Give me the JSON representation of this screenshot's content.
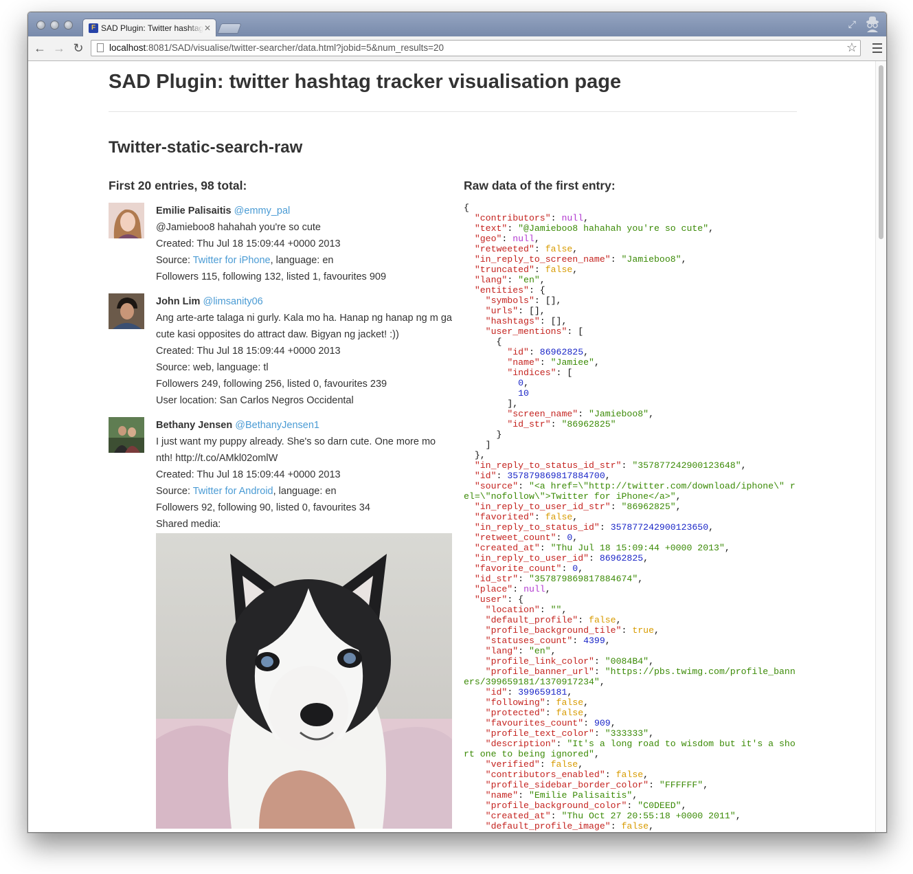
{
  "browser": {
    "tab_title": "SAD Plugin: Twitter hashtag tracker visualisation page",
    "url_host": "localhost",
    "url_rest": ":8081/SAD/visualise/twitter-searcher/data.html?jobid=5&num_results=20"
  },
  "page": {
    "title": "SAD Plugin: twitter hashtag tracker visualisation page",
    "section": "Twitter-static-search-raw",
    "entries_heading": "First 20 entries, 98 total:",
    "raw_heading": "Raw data of the first entry:"
  },
  "tweets": [
    {
      "name": "Emilie Palisaitis",
      "handle": "@emmy_pal",
      "text": "@Jamieboo8 hahahah you're so cute",
      "created": "Created: Thu Jul 18 15:09:44 +0000 2013",
      "source_prefix": "Source: ",
      "source_link": "Twitter for iPhone",
      "source_suffix": ", language: en",
      "stats": "Followers 115, following 132, listed 1, favourites 909"
    },
    {
      "name": "John Lim",
      "handle": "@limsanity06",
      "text": "Ang arte-arte talaga ni gurly. Kala mo ha. Hanap ng hanap ng m ga cute kasi opposites do attract daw. Bigyan ng jacket! :))",
      "created": "Created: Thu Jul 18 15:09:44 +0000 2013",
      "source_prefix": "Source: web, language: tl",
      "stats": "Followers 249, following 256, listed 0, favourites 239",
      "location": "User location: San Carlos Negros Occidental"
    },
    {
      "name": "Bethany Jensen",
      "handle": "@BethanyJensen1",
      "text": "I just want my puppy already. She's so darn cute. One more mo nth! http://t.co/AMkl02omlW",
      "created": "Created: Thu Jul 18 15:09:44 +0000 2013",
      "source_prefix": "Source: ",
      "source_link": "Twitter for Android",
      "source_suffix": ", language: en",
      "stats": "Followers 92, following 90, listed 0, favourites 34",
      "media_label": "Shared media:"
    }
  ],
  "raw_json_lines": [
    [
      [
        "p",
        "{"
      ]
    ],
    [
      [
        "p",
        "  "
      ],
      [
        "k",
        "\"contributors\""
      ],
      [
        "p",
        ": "
      ],
      [
        "nl",
        "null"
      ],
      [
        "p",
        ","
      ]
    ],
    [
      [
        "p",
        "  "
      ],
      [
        "k",
        "\"text\""
      ],
      [
        "p",
        ": "
      ],
      [
        "s",
        "\"@Jamieboo8 hahahah you're so cute\""
      ],
      [
        "p",
        ","
      ]
    ],
    [
      [
        "p",
        "  "
      ],
      [
        "k",
        "\"geo\""
      ],
      [
        "p",
        ": "
      ],
      [
        "nl",
        "null"
      ],
      [
        "p",
        ","
      ]
    ],
    [
      [
        "p",
        "  "
      ],
      [
        "k",
        "\"retweeted\""
      ],
      [
        "p",
        ": "
      ],
      [
        "b",
        "false"
      ],
      [
        "p",
        ","
      ]
    ],
    [
      [
        "p",
        "  "
      ],
      [
        "k",
        "\"in_reply_to_screen_name\""
      ],
      [
        "p",
        ": "
      ],
      [
        "s",
        "\"Jamieboo8\""
      ],
      [
        "p",
        ","
      ]
    ],
    [
      [
        "p",
        "  "
      ],
      [
        "k",
        "\"truncated\""
      ],
      [
        "p",
        ": "
      ],
      [
        "b",
        "false"
      ],
      [
        "p",
        ","
      ]
    ],
    [
      [
        "p",
        "  "
      ],
      [
        "k",
        "\"lang\""
      ],
      [
        "p",
        ": "
      ],
      [
        "s",
        "\"en\""
      ],
      [
        "p",
        ","
      ]
    ],
    [
      [
        "p",
        "  "
      ],
      [
        "k",
        "\"entities\""
      ],
      [
        "p",
        ": {"
      ]
    ],
    [
      [
        "p",
        "    "
      ],
      [
        "k",
        "\"symbols\""
      ],
      [
        "p",
        ": [],"
      ]
    ],
    [
      [
        "p",
        "    "
      ],
      [
        "k",
        "\"urls\""
      ],
      [
        "p",
        ": [],"
      ]
    ],
    [
      [
        "p",
        "    "
      ],
      [
        "k",
        "\"hashtags\""
      ],
      [
        "p",
        ": [],"
      ]
    ],
    [
      [
        "p",
        "    "
      ],
      [
        "k",
        "\"user_mentions\""
      ],
      [
        "p",
        ": ["
      ]
    ],
    [
      [
        "p",
        "      {"
      ]
    ],
    [
      [
        "p",
        "        "
      ],
      [
        "k",
        "\"id\""
      ],
      [
        "p",
        ": "
      ],
      [
        "n",
        "86962825"
      ],
      [
        "p",
        ","
      ]
    ],
    [
      [
        "p",
        "        "
      ],
      [
        "k",
        "\"name\""
      ],
      [
        "p",
        ": "
      ],
      [
        "s",
        "\"Jamiee\""
      ],
      [
        "p",
        ","
      ]
    ],
    [
      [
        "p",
        "        "
      ],
      [
        "k",
        "\"indices\""
      ],
      [
        "p",
        ": ["
      ]
    ],
    [
      [
        "p",
        "          "
      ],
      [
        "n",
        "0"
      ],
      [
        "p",
        ","
      ]
    ],
    [
      [
        "p",
        "          "
      ],
      [
        "n",
        "10"
      ]
    ],
    [
      [
        "p",
        "        ],"
      ]
    ],
    [
      [
        "p",
        "        "
      ],
      [
        "k",
        "\"screen_name\""
      ],
      [
        "p",
        ": "
      ],
      [
        "s",
        "\"Jamieboo8\""
      ],
      [
        "p",
        ","
      ]
    ],
    [
      [
        "p",
        "        "
      ],
      [
        "k",
        "\"id_str\""
      ],
      [
        "p",
        ": "
      ],
      [
        "s",
        "\"86962825\""
      ]
    ],
    [
      [
        "p",
        "      }"
      ]
    ],
    [
      [
        "p",
        "    ]"
      ]
    ],
    [
      [
        "p",
        "  },"
      ]
    ],
    [
      [
        "p",
        "  "
      ],
      [
        "k",
        "\"in_reply_to_status_id_str\""
      ],
      [
        "p",
        ": "
      ],
      [
        "s",
        "\"357877242900123648\""
      ],
      [
        "p",
        ","
      ]
    ],
    [
      [
        "p",
        "  "
      ],
      [
        "k",
        "\"id\""
      ],
      [
        "p",
        ": "
      ],
      [
        "n",
        "357879869817884700"
      ],
      [
        "p",
        ","
      ]
    ],
    [
      [
        "p",
        "  "
      ],
      [
        "k",
        "\"source\""
      ],
      [
        "p",
        ": "
      ],
      [
        "s",
        "\"<a href=\\\"http://twitter.com/download/iphone\\\" rel=\\\"nofollow\\\">Twitter for iPhone</a>\""
      ],
      [
        "p",
        ","
      ]
    ],
    [
      [
        "p",
        "  "
      ],
      [
        "k",
        "\"in_reply_to_user_id_str\""
      ],
      [
        "p",
        ": "
      ],
      [
        "s",
        "\"86962825\""
      ],
      [
        "p",
        ","
      ]
    ],
    [
      [
        "p",
        "  "
      ],
      [
        "k",
        "\"favorited\""
      ],
      [
        "p",
        ": "
      ],
      [
        "b",
        "false"
      ],
      [
        "p",
        ","
      ]
    ],
    [
      [
        "p",
        "  "
      ],
      [
        "k",
        "\"in_reply_to_status_id\""
      ],
      [
        "p",
        ": "
      ],
      [
        "n",
        "357877242900123650"
      ],
      [
        "p",
        ","
      ]
    ],
    [
      [
        "p",
        "  "
      ],
      [
        "k",
        "\"retweet_count\""
      ],
      [
        "p",
        ": "
      ],
      [
        "n",
        "0"
      ],
      [
        "p",
        ","
      ]
    ],
    [
      [
        "p",
        "  "
      ],
      [
        "k",
        "\"created_at\""
      ],
      [
        "p",
        ": "
      ],
      [
        "s",
        "\"Thu Jul 18 15:09:44 +0000 2013\""
      ],
      [
        "p",
        ","
      ]
    ],
    [
      [
        "p",
        "  "
      ],
      [
        "k",
        "\"in_reply_to_user_id\""
      ],
      [
        "p",
        ": "
      ],
      [
        "n",
        "86962825"
      ],
      [
        "p",
        ","
      ]
    ],
    [
      [
        "p",
        "  "
      ],
      [
        "k",
        "\"favorite_count\""
      ],
      [
        "p",
        ": "
      ],
      [
        "n",
        "0"
      ],
      [
        "p",
        ","
      ]
    ],
    [
      [
        "p",
        "  "
      ],
      [
        "k",
        "\"id_str\""
      ],
      [
        "p",
        ": "
      ],
      [
        "s",
        "\"357879869817884674\""
      ],
      [
        "p",
        ","
      ]
    ],
    [
      [
        "p",
        "  "
      ],
      [
        "k",
        "\"place\""
      ],
      [
        "p",
        ": "
      ],
      [
        "nl",
        "null"
      ],
      [
        "p",
        ","
      ]
    ],
    [
      [
        "p",
        "  "
      ],
      [
        "k",
        "\"user\""
      ],
      [
        "p",
        ": {"
      ]
    ],
    [
      [
        "p",
        "    "
      ],
      [
        "k",
        "\"location\""
      ],
      [
        "p",
        ": "
      ],
      [
        "s",
        "\"\""
      ],
      [
        "p",
        ","
      ]
    ],
    [
      [
        "p",
        "    "
      ],
      [
        "k",
        "\"default_profile\""
      ],
      [
        "p",
        ": "
      ],
      [
        "b",
        "false"
      ],
      [
        "p",
        ","
      ]
    ],
    [
      [
        "p",
        "    "
      ],
      [
        "k",
        "\"profile_background_tile\""
      ],
      [
        "p",
        ": "
      ],
      [
        "b",
        "true"
      ],
      [
        "p",
        ","
      ]
    ],
    [
      [
        "p",
        "    "
      ],
      [
        "k",
        "\"statuses_count\""
      ],
      [
        "p",
        ": "
      ],
      [
        "n",
        "4399"
      ],
      [
        "p",
        ","
      ]
    ],
    [
      [
        "p",
        "    "
      ],
      [
        "k",
        "\"lang\""
      ],
      [
        "p",
        ": "
      ],
      [
        "s",
        "\"en\""
      ],
      [
        "p",
        ","
      ]
    ],
    [
      [
        "p",
        "    "
      ],
      [
        "k",
        "\"profile_link_color\""
      ],
      [
        "p",
        ": "
      ],
      [
        "s",
        "\"0084B4\""
      ],
      [
        "p",
        ","
      ]
    ],
    [
      [
        "p",
        "    "
      ],
      [
        "k",
        "\"profile_banner_url\""
      ],
      [
        "p",
        ": "
      ],
      [
        "s",
        "\"https://pbs.twimg.com/profile_banners/399659181/1370917234\""
      ],
      [
        "p",
        ","
      ]
    ],
    [
      [
        "p",
        "    "
      ],
      [
        "k",
        "\"id\""
      ],
      [
        "p",
        ": "
      ],
      [
        "n",
        "399659181"
      ],
      [
        "p",
        ","
      ]
    ],
    [
      [
        "p",
        "    "
      ],
      [
        "k",
        "\"following\""
      ],
      [
        "p",
        ": "
      ],
      [
        "b",
        "false"
      ],
      [
        "p",
        ","
      ]
    ],
    [
      [
        "p",
        "    "
      ],
      [
        "k",
        "\"protected\""
      ],
      [
        "p",
        ": "
      ],
      [
        "b",
        "false"
      ],
      [
        "p",
        ","
      ]
    ],
    [
      [
        "p",
        "    "
      ],
      [
        "k",
        "\"favourites_count\""
      ],
      [
        "p",
        ": "
      ],
      [
        "n",
        "909"
      ],
      [
        "p",
        ","
      ]
    ],
    [
      [
        "p",
        "    "
      ],
      [
        "k",
        "\"profile_text_color\""
      ],
      [
        "p",
        ": "
      ],
      [
        "s",
        "\"333333\""
      ],
      [
        "p",
        ","
      ]
    ],
    [
      [
        "p",
        "    "
      ],
      [
        "k",
        "\"description\""
      ],
      [
        "p",
        ": "
      ],
      [
        "s",
        "\"It's a long road to wisdom but it's a short one to being ignored\""
      ],
      [
        "p",
        ","
      ]
    ],
    [
      [
        "p",
        "    "
      ],
      [
        "k",
        "\"verified\""
      ],
      [
        "p",
        ": "
      ],
      [
        "b",
        "false"
      ],
      [
        "p",
        ","
      ]
    ],
    [
      [
        "p",
        "    "
      ],
      [
        "k",
        "\"contributors_enabled\""
      ],
      [
        "p",
        ": "
      ],
      [
        "b",
        "false"
      ],
      [
        "p",
        ","
      ]
    ],
    [
      [
        "p",
        "    "
      ],
      [
        "k",
        "\"profile_sidebar_border_color\""
      ],
      [
        "p",
        ": "
      ],
      [
        "s",
        "\"FFFFFF\""
      ],
      [
        "p",
        ","
      ]
    ],
    [
      [
        "p",
        "    "
      ],
      [
        "k",
        "\"name\""
      ],
      [
        "p",
        ": "
      ],
      [
        "s",
        "\"Emilie Palisaitis\""
      ],
      [
        "p",
        ","
      ]
    ],
    [
      [
        "p",
        "    "
      ],
      [
        "k",
        "\"profile_background_color\""
      ],
      [
        "p",
        ": "
      ],
      [
        "s",
        "\"C0DEED\""
      ],
      [
        "p",
        ","
      ]
    ],
    [
      [
        "p",
        "    "
      ],
      [
        "k",
        "\"created_at\""
      ],
      [
        "p",
        ": "
      ],
      [
        "s",
        "\"Thu Oct 27 20:55:18 +0000 2011\""
      ],
      [
        "p",
        ","
      ]
    ],
    [
      [
        "p",
        "    "
      ],
      [
        "k",
        "\"default_profile_image\""
      ],
      [
        "p",
        ": "
      ],
      [
        "b",
        "false"
      ],
      [
        "p",
        ","
      ]
    ]
  ],
  "colors": {
    "json_key": "#c4231f",
    "json_string": "#3b8a06",
    "json_number": "#1a26c7",
    "json_bool": "#d89b00",
    "json_null": "#b23ad0",
    "link": "#4a9bd4"
  }
}
